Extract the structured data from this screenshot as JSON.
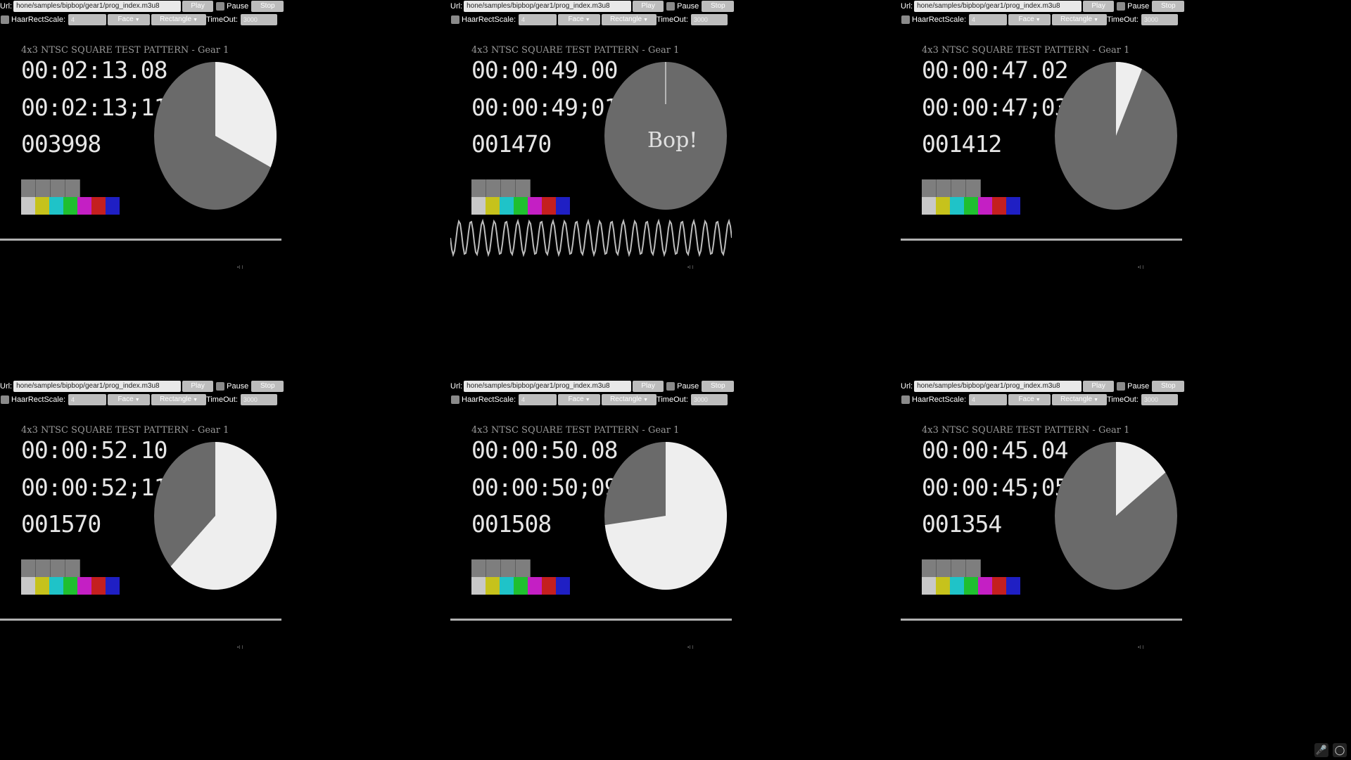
{
  "controls": {
    "url_label": "Url:",
    "url_value": "hone/samples/bipbop/gear1/prog_index.m3u8",
    "play_label": "Play",
    "pause_label": "Pause",
    "stop_label": "Stop",
    "haar_label": "HaarRectScale:",
    "haar_value": "4",
    "face_select": "Face",
    "rect_select": "Rectangle",
    "timeout_label": "TimeOut:",
    "timeout_value": "3000"
  },
  "pattern_title": "4x3 NTSC SQUARE TEST PATTERN - Gear 1",
  "players": [
    {
      "time": "00:02:13.08",
      "smpte": "00:02:13;11",
      "frame": "003998",
      "pie_fraction": 0.32,
      "bop": "",
      "wave": false
    },
    {
      "time": "00:00:49.00",
      "smpte": "00:00:49;01",
      "frame": "001470",
      "pie_fraction": 0.0,
      "bop": "Bop!",
      "wave": true
    },
    {
      "time": "00:00:47.02",
      "smpte": "00:00:47;03",
      "frame": "001412",
      "pie_fraction": 0.07,
      "bop": "",
      "wave": false
    },
    {
      "time": "00:00:52.10",
      "smpte": "00:00:52;11",
      "frame": "001570",
      "pie_fraction": 0.63,
      "bop": "",
      "wave": false
    },
    {
      "time": "00:00:50.08",
      "smpte": "00:00:50;09",
      "frame": "001508",
      "pie_fraction": 0.73,
      "bop": "",
      "wave": false
    },
    {
      "time": "00:00:45.04",
      "smpte": "00:00:45;05",
      "frame": "001354",
      "pie_fraction": 0.15,
      "bop": "",
      "wave": false
    }
  ],
  "colors": {
    "pie_base": "#6a6a6a",
    "pie_fill": "#eeeeee",
    "bars_top": [
      "#7e7e7e",
      "#7e7e7e",
      "#7e7e7e",
      "#7e7e7e"
    ],
    "bars_bottom": [
      "#c8c8c8",
      "#c6c21c",
      "#1fc3c8",
      "#1fbf2f",
      "#c41fc4",
      "#c41f1f",
      "#1f1fc4"
    ]
  },
  "mini_label": "•I I",
  "system_icons": [
    "mic-icon",
    "refresh-icon"
  ]
}
